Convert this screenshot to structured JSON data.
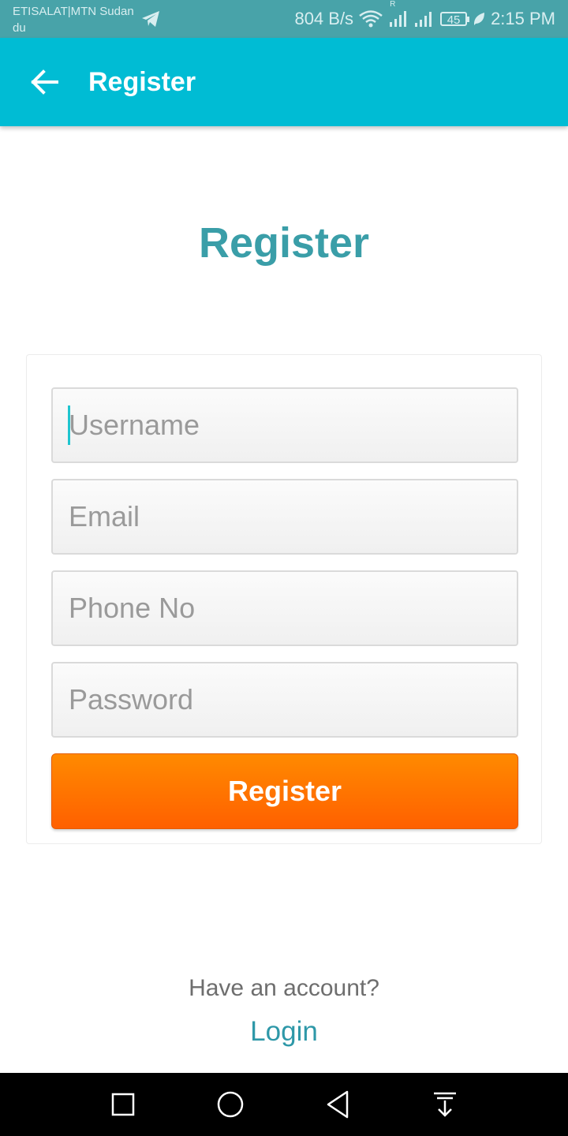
{
  "status_bar": {
    "carrier_line1": "ETISALAT|MTN Sudan",
    "carrier_line2": "du",
    "net_speed": "804 B/s",
    "roaming_indicator": "R",
    "battery_level": "45",
    "time": "2:15 PM",
    "icons": [
      "telegram-icon",
      "wifi-icon",
      "signal-icon",
      "signal-icon",
      "battery-icon",
      "leaf-icon"
    ]
  },
  "app_bar": {
    "title": "Register",
    "back_icon": "arrow-left-icon",
    "background": "#00bcd4"
  },
  "form": {
    "heading": "Register",
    "username_placeholder": "Username",
    "email_placeholder": "Email",
    "phone_placeholder": "Phone No",
    "password_placeholder": "Password",
    "submit_label": "Register",
    "submit_color": "#ff7300"
  },
  "footer": {
    "prompt": "Have an account?",
    "login_label": "Login"
  },
  "nav_bar": {
    "icons": [
      "recents-icon",
      "home-icon",
      "back-icon",
      "notification-pull-icon"
    ]
  }
}
